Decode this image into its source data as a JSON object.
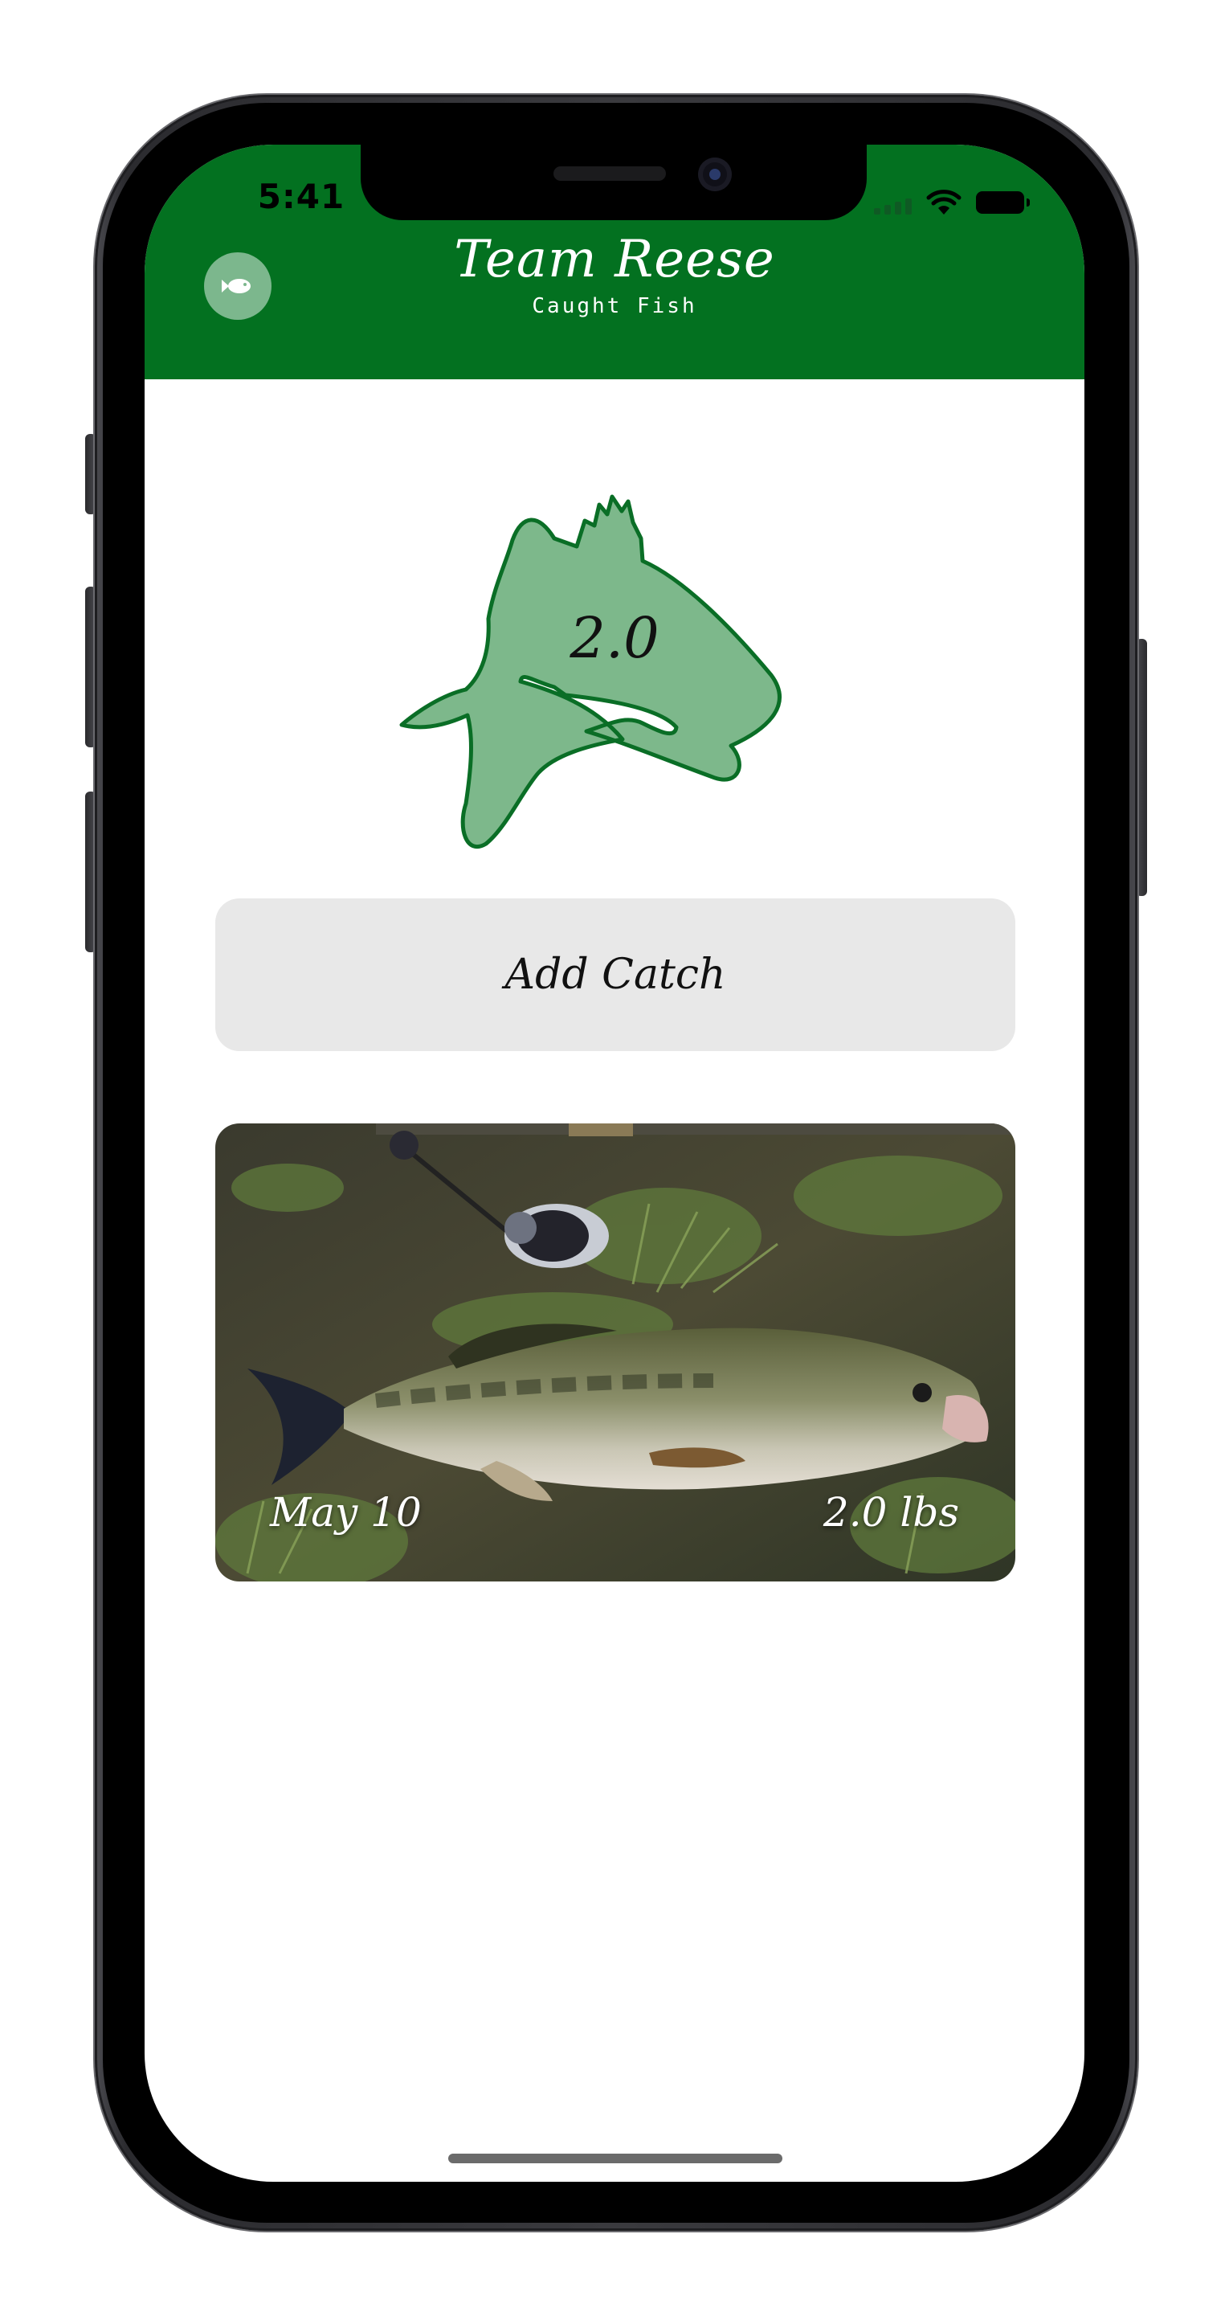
{
  "status_bar": {
    "time": "5:41"
  },
  "header": {
    "title": "Team Reese",
    "subtitle": "Caught Fish",
    "background_color": "#037120",
    "menu_icon": "fish-icon"
  },
  "total_weight": {
    "value": "2.0",
    "fill_color": "#7db88b",
    "stroke_color": "#0a6e26"
  },
  "add_catch_button": {
    "label": "Add Catch"
  },
  "catches": [
    {
      "date": "May 10",
      "weight": "2.0 lbs"
    }
  ]
}
